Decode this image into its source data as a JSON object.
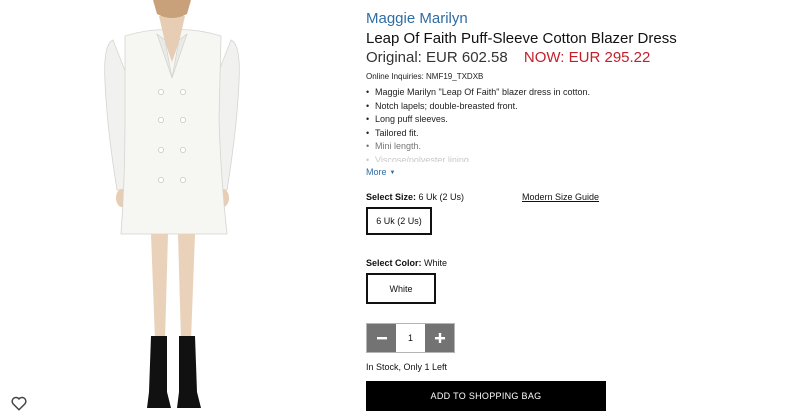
{
  "product": {
    "brand": "Maggie Marilyn",
    "title": "Leap Of Faith Puff-Sleeve Cotton Blazer Dress",
    "price_original": "Original: EUR 602.58",
    "price_now": "NOW: EUR 295.22",
    "inquiries": "Online Inquiries: NMF19_TXDXB",
    "features": [
      "Maggie Marilyn \"Leap Of Faith\" blazer dress in cotton.",
      "Notch lapels; double-breasted front.",
      "Long puff sleeves.",
      "Tailored fit.",
      "Mini length.",
      "Viscose/polyester lining."
    ],
    "more_label": "More",
    "image_icon": "product-photo-white-blazer-dress"
  },
  "size": {
    "label": "Select Size:",
    "selected": "6 Uk (2 Us)",
    "guide_label": "Modern Size Guide",
    "options": [
      "6 Uk (2 Us)"
    ]
  },
  "color": {
    "label": "Select Color:",
    "selected": "White",
    "options": [
      "White"
    ]
  },
  "quantity": {
    "value": "1",
    "minus_icon": "minus-icon",
    "plus_icon": "plus-icon"
  },
  "stock_text": "In Stock, Only 1 Left",
  "add_to_bag_label": "ADD TO SHOPPING BAG",
  "wishlist_icon": "heart-outline-icon",
  "colors": {
    "brand_link": "#2e6da4",
    "sale_price": "#c41e2b",
    "button_bg": "#000000",
    "stepper_bg": "#737373"
  }
}
